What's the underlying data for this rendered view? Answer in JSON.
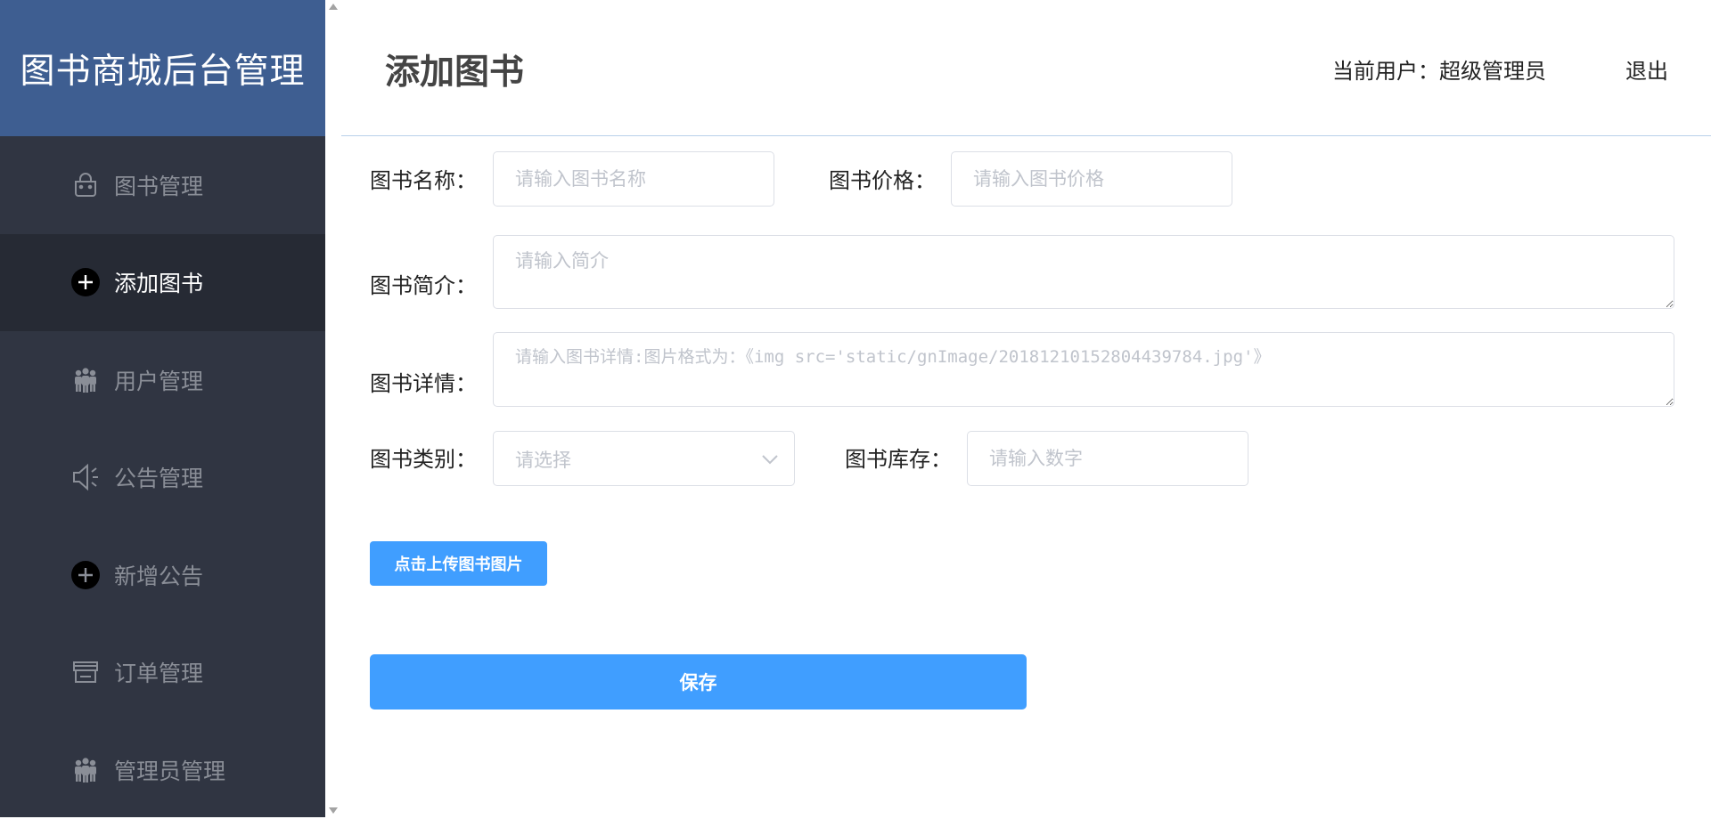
{
  "app": {
    "brand": "图书商城后台管理"
  },
  "sidebar": {
    "items": [
      {
        "label": "图书管理",
        "icon": "shopping-bag-icon"
      },
      {
        "label": "添加图书",
        "icon": "plus-circle-icon",
        "active": true
      },
      {
        "label": "用户管理",
        "icon": "users-icon"
      },
      {
        "label": "公告管理",
        "icon": "megaphone-icon"
      },
      {
        "label": "新增公告",
        "icon": "plus-circle-icon"
      },
      {
        "label": "订单管理",
        "icon": "store-icon"
      },
      {
        "label": "管理员管理",
        "icon": "users-icon"
      }
    ]
  },
  "header": {
    "title": "添加图书",
    "current_user": "当前用户：超级管理员",
    "logout": "退出"
  },
  "form": {
    "name": {
      "label": "图书名称：",
      "placeholder": "请输入图书名称"
    },
    "price": {
      "label": "图书价格：",
      "placeholder": "请输入图书价格"
    },
    "intro": {
      "label": "图书简介：",
      "placeholder": "请输入简介"
    },
    "detail": {
      "label": "图书详情：",
      "placeholder": "请输入图书详情:图片格式为：《img src='static/gnImage/20181210152804439784.jpg'》"
    },
    "category": {
      "label": "图书类别：",
      "placeholder": "请选择"
    },
    "stock": {
      "label": "图书库存：",
      "placeholder": "请输入数字"
    },
    "upload_button": "点击上传图书图片",
    "save_button": "保存"
  },
  "colors": {
    "sidebar_bg": "#303542",
    "sidebar_active_bg": "#262a34",
    "brand_bg": "#3e5e91",
    "primary": "#409eff",
    "input_border": "#dcdfe6",
    "header_divider": "#b9d1ea"
  }
}
